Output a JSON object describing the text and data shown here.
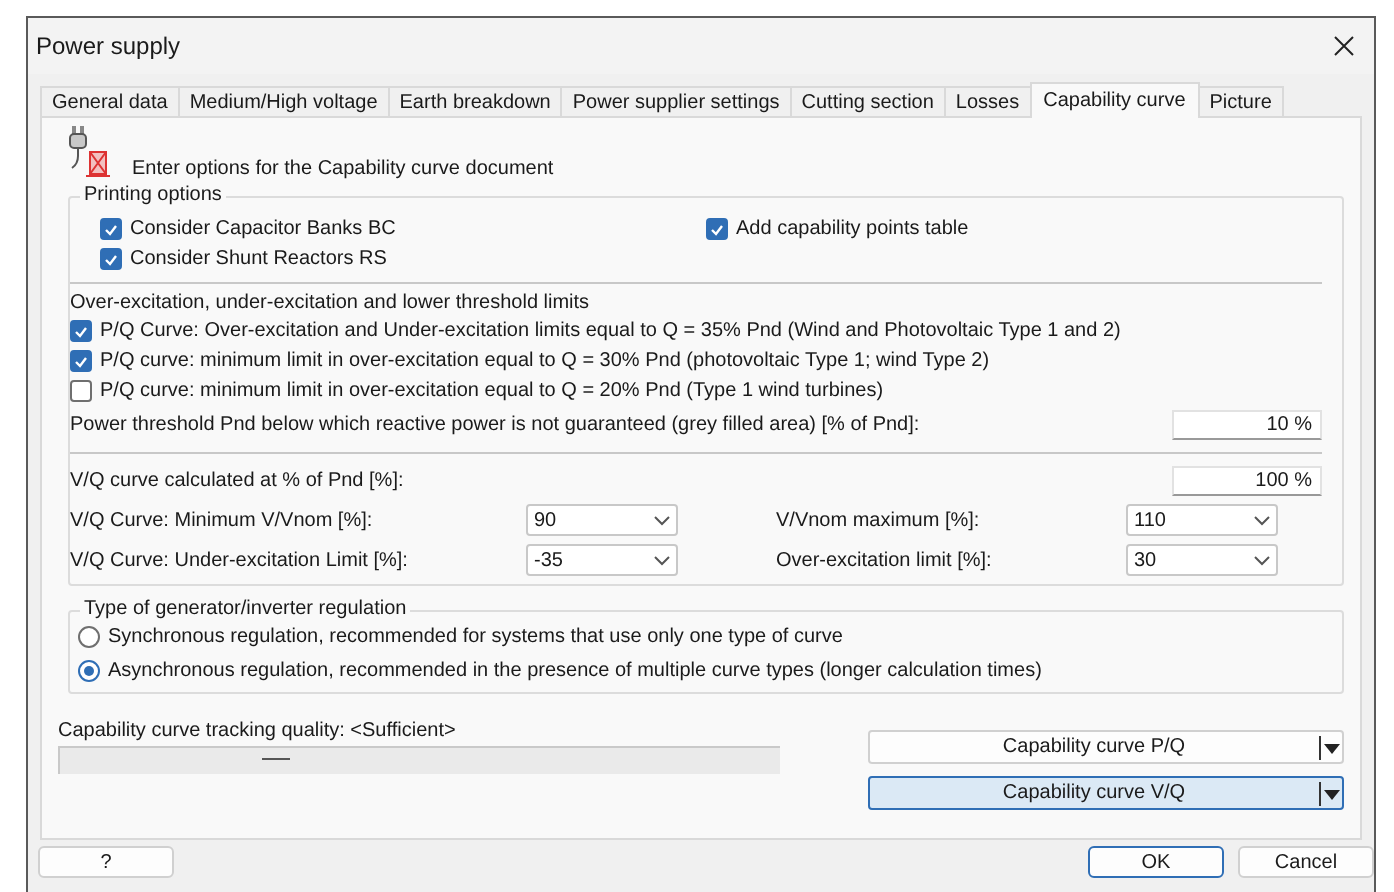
{
  "window": {
    "title": "Power supply"
  },
  "tabs": [
    {
      "label": "General data",
      "selected": false
    },
    {
      "label": "Medium/High voltage",
      "selected": false
    },
    {
      "label": "Earth breakdown",
      "selected": false
    },
    {
      "label": "Power supplier settings",
      "selected": false
    },
    {
      "label": "Cutting section",
      "selected": false
    },
    {
      "label": "Losses",
      "selected": false
    },
    {
      "label": "Capability curve",
      "selected": true
    },
    {
      "label": "Picture",
      "selected": false
    }
  ],
  "header": {
    "text": "Enter options for the Capability curve document"
  },
  "printing_options": {
    "title": "Printing options",
    "checkboxes": [
      {
        "label": "Consider Capacitor Banks BC",
        "checked": true
      },
      {
        "label": "Consider Shunt Reactors RS",
        "checked": true
      },
      {
        "label": "Add capability points table",
        "checked": true
      }
    ]
  },
  "limits": {
    "title": "Over-excitation, under-excitation and lower threshold limits",
    "checkboxes": [
      {
        "label": "P/Q Curve: Over-excitation and Under-excitation limits equal to Q = 35% Pnd (Wind and Photovoltaic Type 1 and 2)",
        "checked": true
      },
      {
        "label": "P/Q curve: minimum limit in over-excitation equal to Q = 30% Pnd (photovoltaic Type 1; wind Type 2)",
        "checked": true
      },
      {
        "label": "P/Q curve: minimum limit in over-excitation equal to Q = 20% Pnd (Type 1 wind turbines)",
        "checked": false
      }
    ],
    "threshold": {
      "label": "Power threshold Pnd below which reactive power is not guaranteed (grey filled area) [% of Pnd]:",
      "value": "10 %"
    }
  },
  "vq": {
    "calculated": {
      "label": "V/Q curve calculated at % of Pnd [%]:",
      "value": "100 %"
    },
    "selects": [
      {
        "label": "V/Q Curve: Minimum V/Vnom [%]:",
        "value": "90"
      },
      {
        "label": "V/Vnom maximum [%]:",
        "value": "110"
      },
      {
        "label": "V/Q Curve: Under-excitation Limit [%]:",
        "value": "-35"
      },
      {
        "label": "Over-excitation limit [%]:",
        "value": "30"
      }
    ]
  },
  "regulation": {
    "title": "Type of generator/inverter regulation",
    "options": [
      {
        "label": "Synchronous regulation, recommended for systems that use only one type of curve",
        "selected": false
      },
      {
        "label": "Asynchronous regulation, recommended in the presence of multiple curve types (longer calculation times)",
        "selected": true
      }
    ]
  },
  "tracking": {
    "label": "Capability curve tracking quality: <Sufficient>",
    "level": 0.28
  },
  "curve_buttons": [
    {
      "label": "Capability curve P/Q",
      "selected": false
    },
    {
      "label": "Capability curve V/Q",
      "selected": true
    }
  ],
  "buttons": {
    "help": "?",
    "ok": "OK",
    "cancel": "Cancel"
  }
}
